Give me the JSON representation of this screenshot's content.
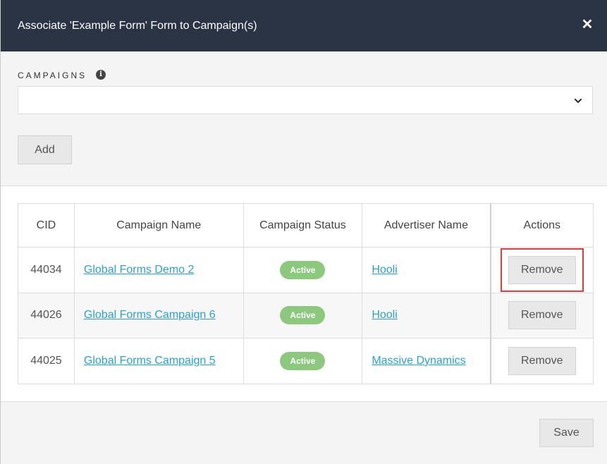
{
  "dialog": {
    "title": "Associate 'Example Form' Form to Campaign(s)",
    "close_icon": "✕"
  },
  "campaigns_field": {
    "label": "CAMPAIGNS",
    "info_icon": "i",
    "selected_value": ""
  },
  "buttons": {
    "add": "Add",
    "save": "Save"
  },
  "table": {
    "headers": [
      "CID",
      "Campaign Name",
      "Campaign Status",
      "Advertiser Name",
      "Actions"
    ],
    "rows": [
      {
        "cid": "44034",
        "campaign_name": "Global Forms Demo 2",
        "status": "Active",
        "advertiser": "Hooli",
        "action": "Remove"
      },
      {
        "cid": "44026",
        "campaign_name": "Global Forms Campaign 6",
        "status": "Active",
        "advertiser": "Hooli",
        "action": "Remove"
      },
      {
        "cid": "44025",
        "campaign_name": "Global Forms Campaign 5",
        "status": "Active",
        "advertiser": "Massive Dynamics",
        "action": "Remove"
      }
    ]
  },
  "colors": {
    "header_bg": "#2b3444",
    "link": "#2a9fd8",
    "status_active": "#8cc87d",
    "highlight": "#e03c3c"
  }
}
